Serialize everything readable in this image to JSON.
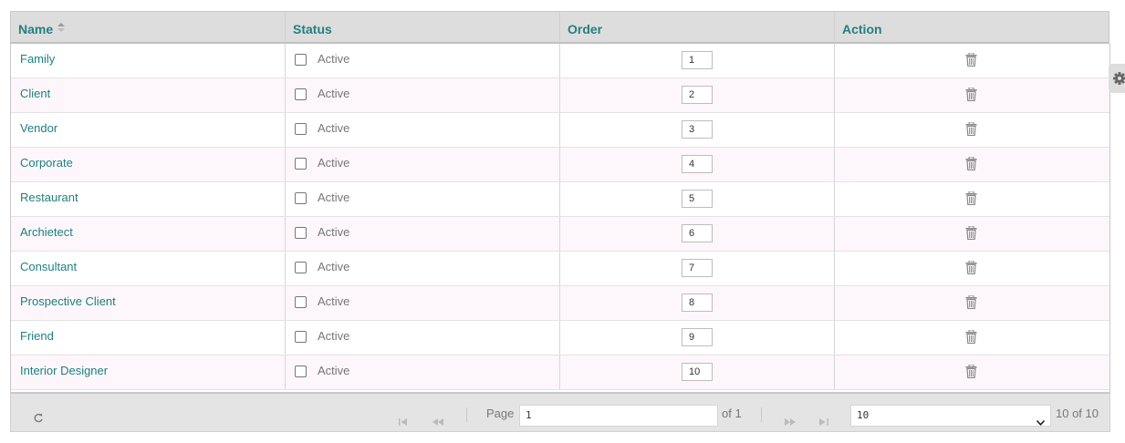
{
  "table": {
    "columns": [
      {
        "label": "Name",
        "sortable": true
      },
      {
        "label": "Status"
      },
      {
        "label": "Order"
      },
      {
        "label": "Action"
      }
    ],
    "rows": [
      {
        "name": "Family",
        "status": "Active",
        "order": "1"
      },
      {
        "name": "Client",
        "status": "Active",
        "order": "2"
      },
      {
        "name": "Vendor",
        "status": "Active",
        "order": "3"
      },
      {
        "name": "Corporate",
        "status": "Active",
        "order": "4"
      },
      {
        "name": "Restaurant",
        "status": "Active",
        "order": "5"
      },
      {
        "name": "Archietect",
        "status": "Active",
        "order": "6"
      },
      {
        "name": "Consultant",
        "status": "Active",
        "order": "7"
      },
      {
        "name": "Prospective Client",
        "status": "Active",
        "order": "8"
      },
      {
        "name": "Friend",
        "status": "Active",
        "order": "9"
      },
      {
        "name": "Interior Designer",
        "status": "Active",
        "order": "10"
      }
    ]
  },
  "pager": {
    "page_label": "Page",
    "page_value": "1",
    "of_label": "of 1",
    "page_size": "10",
    "records_label": "10 of 10"
  },
  "icons": {
    "refresh": "refresh-icon",
    "first": "first-page-icon",
    "prev": "prev-page-icon",
    "next": "next-page-icon",
    "last": "last-page-icon",
    "trash": "trash-icon",
    "settings": "gear-icon"
  },
  "colors": {
    "link": "#1f8080",
    "header_bg": "#dddddd",
    "alt_row": "#fdf7fb"
  }
}
